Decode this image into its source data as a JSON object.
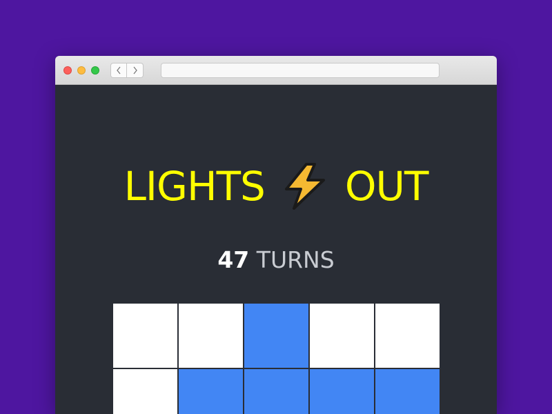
{
  "browser": {
    "url": ""
  },
  "game": {
    "title_left": "LIGHTS",
    "title_icon": "lightning-bolt-icon",
    "title_right": "OUT",
    "turn_count": "47",
    "turn_label": "TURNS",
    "board": [
      [
        "off",
        "off",
        "on",
        "off",
        "off"
      ],
      [
        "off",
        "on",
        "on",
        "on",
        "on"
      ]
    ]
  },
  "colors": {
    "background": "#4e16a0",
    "page_background": "#292d35",
    "title": "#ffff00",
    "light_on": "#4286f4",
    "light_off": "#ffffff"
  }
}
